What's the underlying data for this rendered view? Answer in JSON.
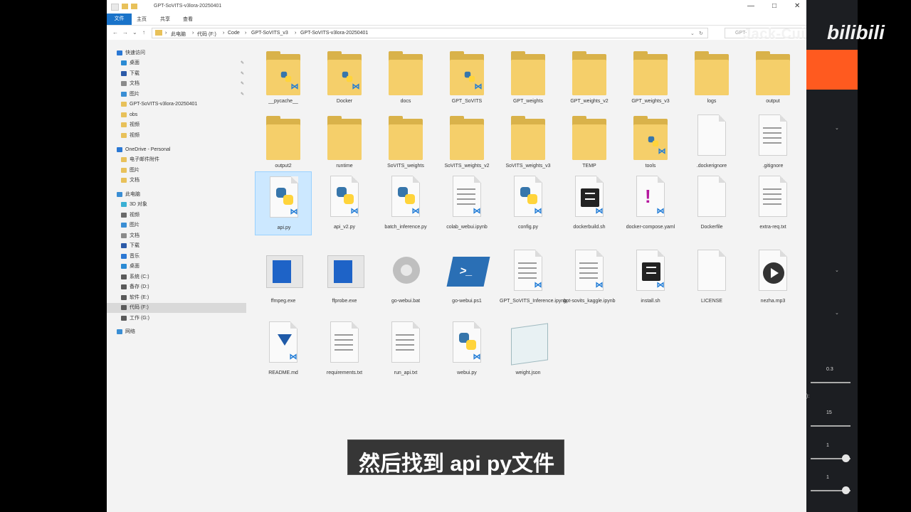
{
  "window": {
    "title": "GPT-SoVITS-v3lora-20250401",
    "ribbon_tabs": [
      "文件",
      "主页",
      "共享",
      "查看"
    ],
    "address_parts": [
      "此电脑",
      "代码 (F:)",
      "Code",
      "GPT-SoVITS_v3",
      "GPT-SoVITS-v3lora-20250401"
    ],
    "search_placeholder": "GPT-"
  },
  "nav": [
    {
      "label": "快速访问",
      "icon": "star-icon",
      "color": "#2b78d4",
      "level": 0,
      "pinned": false
    },
    {
      "label": "桌面",
      "icon": "desktop-icon",
      "color": "#2b8bd4",
      "level": 1,
      "pinned": true
    },
    {
      "label": "下载",
      "icon": "download-icon",
      "color": "#2b5aa8",
      "level": 1,
      "pinned": true
    },
    {
      "label": "文档",
      "icon": "document-icon",
      "color": "#8a8a8a",
      "level": 1,
      "pinned": true
    },
    {
      "label": "图片",
      "icon": "picture-icon",
      "color": "#3a8ed4",
      "level": 1,
      "pinned": true
    },
    {
      "label": "GPT-SoVITS-v3lora-20250401",
      "icon": "folder-icon",
      "color": "#e8c15a",
      "level": 1,
      "pinned": false
    },
    {
      "label": "obs",
      "icon": "folder-icon",
      "color": "#e8c15a",
      "level": 1,
      "pinned": false
    },
    {
      "label": "视频",
      "icon": "folder-icon",
      "color": "#e8c15a",
      "level": 1,
      "pinned": false
    },
    {
      "label": "视频",
      "icon": "folder-icon",
      "color": "#e8c15a",
      "level": 1,
      "pinned": false
    },
    {
      "label": "OneDrive - Personal",
      "icon": "cloud-icon",
      "color": "#2b78d4",
      "level": 0,
      "pinned": false
    },
    {
      "label": "电子邮件附件",
      "icon": "folder-icon",
      "color": "#e8c15a",
      "level": 1,
      "pinned": false
    },
    {
      "label": "图片",
      "icon": "folder-icon",
      "color": "#e8c15a",
      "level": 1,
      "pinned": false
    },
    {
      "label": "文档",
      "icon": "folder-icon",
      "color": "#e8c15a",
      "level": 1,
      "pinned": false
    },
    {
      "label": "此电脑",
      "icon": "computer-icon",
      "color": "#3a8ed4",
      "level": 0,
      "pinned": false
    },
    {
      "label": "3D 对象",
      "icon": "cube-icon",
      "color": "#3ab0d4",
      "level": 1,
      "pinned": false
    },
    {
      "label": "视频",
      "icon": "video-icon",
      "color": "#6a6a6a",
      "level": 1,
      "pinned": false
    },
    {
      "label": "图片",
      "icon": "picture-icon",
      "color": "#3a8ed4",
      "level": 1,
      "pinned": false
    },
    {
      "label": "文档",
      "icon": "document-icon",
      "color": "#8a8a8a",
      "level": 1,
      "pinned": false
    },
    {
      "label": "下载",
      "icon": "download-icon",
      "color": "#2b5aa8",
      "level": 1,
      "pinned": false
    },
    {
      "label": "音乐",
      "icon": "music-icon",
      "color": "#2b78d4",
      "level": 1,
      "pinned": false
    },
    {
      "label": "桌面",
      "icon": "desktop-icon",
      "color": "#2b8bd4",
      "level": 1,
      "pinned": false
    },
    {
      "label": "系统 (C:)",
      "icon": "drive-icon",
      "color": "#5a5a5a",
      "level": 1,
      "pinned": false
    },
    {
      "label": "备存 (D:)",
      "icon": "drive-icon",
      "color": "#5a5a5a",
      "level": 1,
      "pinned": false
    },
    {
      "label": "软件 (E:)",
      "icon": "drive-icon",
      "color": "#5a5a5a",
      "level": 1,
      "pinned": false
    },
    {
      "label": "代码 (F:)",
      "icon": "drive-icon",
      "color": "#5a5a5a",
      "level": 1,
      "pinned": false,
      "selected": true
    },
    {
      "label": "工作 (G:)",
      "icon": "drive-icon",
      "color": "#5a5a5a",
      "level": 1,
      "pinned": false
    },
    {
      "label": "网络",
      "icon": "network-icon",
      "color": "#3a8ed4",
      "level": 0,
      "pinned": false
    }
  ],
  "files": [
    {
      "name": "__pycache__",
      "kind": "folder-py"
    },
    {
      "name": "Docker",
      "kind": "folder-py"
    },
    {
      "name": "docs",
      "kind": "folder"
    },
    {
      "name": "GPT_SoVITS",
      "kind": "folder-py"
    },
    {
      "name": "GPT_weights",
      "kind": "folder"
    },
    {
      "name": "GPT_weights_v2",
      "kind": "folder"
    },
    {
      "name": "GPT_weights_v3",
      "kind": "folder"
    },
    {
      "name": "logs",
      "kind": "folder"
    },
    {
      "name": "output",
      "kind": "folder"
    },
    {
      "name": "output2",
      "kind": "folder"
    },
    {
      "name": "runtime",
      "kind": "folder"
    },
    {
      "name": "SoVITS_weights",
      "kind": "folder"
    },
    {
      "name": "SoVITS_weights_v2",
      "kind": "folder"
    },
    {
      "name": "SoVITS_weights_v3",
      "kind": "folder"
    },
    {
      "name": "TEMP",
      "kind": "folder"
    },
    {
      "name": "tools",
      "kind": "folder-py"
    },
    {
      "name": ".dockerignore",
      "kind": "blank"
    },
    {
      "name": ".gitignore",
      "kind": "text"
    },
    {
      "name": "api.py",
      "kind": "python",
      "selected": true
    },
    {
      "name": "api_v2.py",
      "kind": "python"
    },
    {
      "name": "batch_inference.py",
      "kind": "python"
    },
    {
      "name": "colab_webui.ipynb",
      "kind": "code"
    },
    {
      "name": "config.py",
      "kind": "python"
    },
    {
      "name": "dockerbuild.sh",
      "kind": "shell"
    },
    {
      "name": "docker-compose.yaml",
      "kind": "yaml"
    },
    {
      "name": "Dockerfile",
      "kind": "blank"
    },
    {
      "name": "extra-req.txt",
      "kind": "text"
    },
    {
      "name": "ffmpeg.exe",
      "kind": "exe"
    },
    {
      "name": "ffprobe.exe",
      "kind": "exe"
    },
    {
      "name": "go-webui.bat",
      "kind": "bat"
    },
    {
      "name": "go-webui.ps1",
      "kind": "ps1"
    },
    {
      "name": "GPT_SoVITS_Inference.ipynb",
      "kind": "code"
    },
    {
      "name": "gpt-sovits_kaggle.ipynb",
      "kind": "code"
    },
    {
      "name": "install.sh",
      "kind": "shell"
    },
    {
      "name": "LICENSE",
      "kind": "blank"
    },
    {
      "name": "nezha.mp3",
      "kind": "audio"
    },
    {
      "name": "README.md",
      "kind": "markdown"
    },
    {
      "name": "requirements.txt",
      "kind": "text"
    },
    {
      "name": "run_api.txt",
      "kind": "text"
    },
    {
      "name": "webui.py",
      "kind": "python"
    },
    {
      "name": "weight.json",
      "kind": "json"
    }
  ],
  "right_panel": {
    "values": [
      "0.3",
      "15",
      "1",
      "1"
    ],
    "partial_label": "):"
  },
  "watermark": {
    "name": "Jack-Cui",
    "logo": "bilibili"
  },
  "subtitle": "然后找到 api py文件"
}
